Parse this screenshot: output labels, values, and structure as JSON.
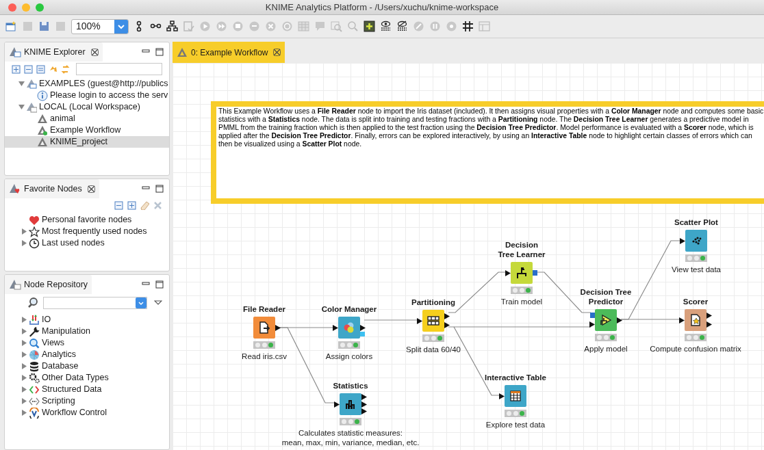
{
  "window": {
    "title": "KNIME Analytics Platform - /Users/xuchu/knime-workspace"
  },
  "toolbar": {
    "zoom": "100%"
  },
  "explorer": {
    "title": "KNIME Explorer",
    "items": [
      {
        "label": "EXAMPLES (guest@http://publics",
        "kind": "server",
        "expanded": true,
        "selected": false,
        "children": [
          {
            "label": "Please login to access the serv",
            "kind": "info",
            "selected": false
          }
        ]
      },
      {
        "label": "LOCAL (Local Workspace)",
        "kind": "local",
        "expanded": true,
        "selected": false,
        "children": [
          {
            "label": "animal",
            "kind": "workflow",
            "selected": false
          },
          {
            "label": "Example Workflow",
            "kind": "workflow-ok",
            "selected": false
          },
          {
            "label": "KNIME_project",
            "kind": "workflow",
            "selected": true
          }
        ]
      }
    ]
  },
  "favorites": {
    "title": "Favorite Nodes",
    "items": [
      {
        "label": "Personal favorite nodes",
        "kind": "heart"
      },
      {
        "label": "Most frequently used nodes",
        "kind": "star",
        "expanded": false
      },
      {
        "label": "Last used nodes",
        "kind": "clock",
        "expanded": false
      }
    ]
  },
  "repository": {
    "title": "Node Repository",
    "items": [
      {
        "label": "IO",
        "kind": "io",
        "expanded": false
      },
      {
        "label": "Manipulation",
        "kind": "wrench",
        "expanded": false
      },
      {
        "label": "Views",
        "kind": "magnifier",
        "expanded": false
      },
      {
        "label": "Analytics",
        "kind": "sphere",
        "expanded": false
      },
      {
        "label": "Database",
        "kind": "database",
        "expanded": false
      },
      {
        "label": "Other Data Types",
        "kind": "gears",
        "expanded": false
      },
      {
        "label": "Structured Data",
        "kind": "brackets",
        "expanded": false
      },
      {
        "label": "Scripting",
        "kind": "scripting",
        "expanded": false
      },
      {
        "label": "Workflow Control",
        "kind": "loop",
        "expanded": false
      }
    ]
  },
  "editor": {
    "tab": {
      "label": "0: Example Workflow",
      "selected": true
    },
    "annotation": "This Example Workflow uses a **File Reader** node to import the Iris dataset (included). It then assigns visual properties with a **Color Manager** node and computes some basic statistics with a **Statistics** node. The data is split into training and testing fractions with a **Partitioning** node. The **Decision Tree Learner** generates a predictive model in PMML from the training fraction which is then applied to the test fraction using the **Decision Tree Predictor**. Model performance is evaluated with a **Scorer** node, which is applied after the **Decision Tree Predictor**. Finally, errors can be explored interactively, by using an **Interactive Table** node to highlight certain classes of errors which can then be visualized using a **Scatter Plot** node.",
    "nodes": [
      {
        "title": "File Reader",
        "kind": "reader",
        "color": "#f28c3a",
        "executed": true,
        "description": "Read iris.csv"
      },
      {
        "title": "Color Manager",
        "kind": "color",
        "color": "#3ea6c8",
        "executed": true,
        "description": "Assign colors"
      },
      {
        "title": "Partitioning",
        "kind": "partition",
        "color": "#f5cf1d",
        "executed": true,
        "description": "Split data 60/40"
      },
      {
        "title": "Statistics",
        "kind": "stats",
        "color": "#3ea6c8",
        "executed": true,
        "description": "Calculates statistic measures:\nmean, max, min, variance, median, etc."
      },
      {
        "title": "Decision\nTree Learner",
        "kind": "learner",
        "color": "#c5d93a",
        "executed": true,
        "description": "Train model"
      },
      {
        "title": "Interactive Table",
        "kind": "table",
        "color": "#3ea6c8",
        "executed": true,
        "description": "Explore test data"
      },
      {
        "title": "Decision Tree\nPredictor",
        "kind": "predictor",
        "color": "#4cbb5a",
        "executed": true,
        "description": "Apply model"
      },
      {
        "title": "Scatter Plot",
        "kind": "scatter",
        "color": "#3ea6c8",
        "executed": true,
        "description": "View test data"
      },
      {
        "title": "Scorer",
        "kind": "scorer",
        "color": "#d9a07c",
        "executed": true,
        "description": "Compute confusion matrix"
      }
    ]
  }
}
